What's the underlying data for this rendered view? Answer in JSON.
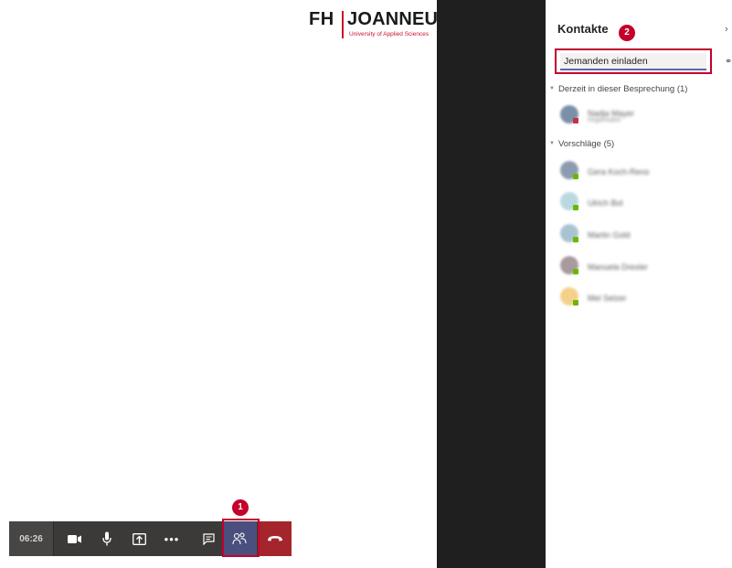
{
  "logo": {
    "fh": "FH",
    "name": "JOANNEUM",
    "subtitle": "University of Applied Sciences"
  },
  "panel": {
    "title": "Kontakte",
    "invite_placeholder": "Jemanden einladen",
    "badge_1": "1",
    "badge_2": "2",
    "sections": [
      {
        "label": "Derzeit in dieser Besprechung (1)"
      },
      {
        "label": "Vorschläge (5)"
      }
    ],
    "current_participants": [
      {
        "name": "Nadja Mayer",
        "sub": "Organisator",
        "avatar_color": "#7a8fa8",
        "presence": "#c4314b"
      }
    ],
    "suggestions": [
      {
        "name": "Gera Koch-Reno",
        "avatar_color": "#8d9bb0",
        "presence": "#6bb700"
      },
      {
        "name": "Ulrich Bol",
        "avatar_color": "#b9d8e0",
        "presence": "#6bb700"
      },
      {
        "name": "Martin Gold",
        "avatar_color": "#a9c3d2",
        "presence": "#6bb700"
      },
      {
        "name": "Manuela Drexler",
        "avatar_color": "#a89a9e",
        "presence": "#6bb700"
      },
      {
        "name": "Mel Selzer",
        "avatar_color": "#f3d18a",
        "presence": "#6bb700"
      }
    ]
  },
  "toolbar": {
    "timer": "06:26",
    "video_icon": "video-camera-icon",
    "mic_icon": "microphone-icon",
    "share_icon": "share-screen-icon",
    "more_label": "•••",
    "chat_icon": "chat-icon",
    "people_icon": "people-icon",
    "hangup_icon": "hang-up-icon"
  },
  "colors": {
    "accent": "#6264a7",
    "highlight": "#c4002b",
    "hangup": "#a4262c",
    "toolbar_bg": "#3b3a39"
  }
}
